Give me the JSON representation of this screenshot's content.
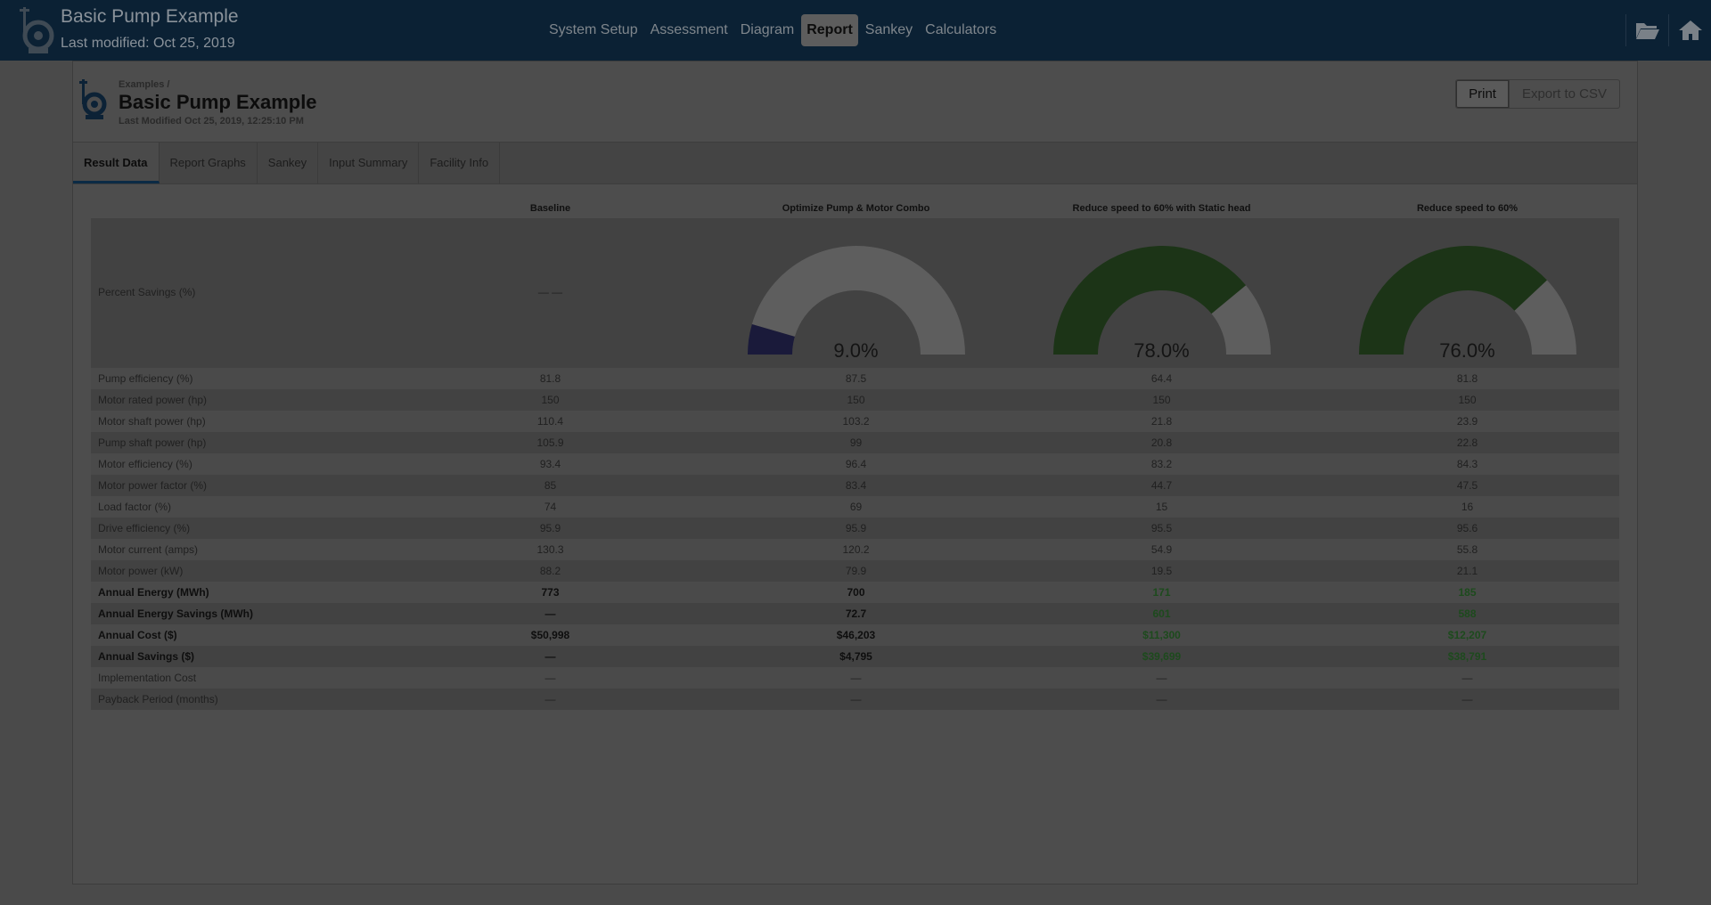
{
  "app": {
    "title": "Basic Pump Example",
    "modified": "Last modified: Oct 25, 2019"
  },
  "nav": {
    "items": [
      "System Setup",
      "Assessment",
      "Diagram",
      "Report",
      "Sankey",
      "Calculators"
    ],
    "active": "Report"
  },
  "icons": {
    "folder": "folder-open-icon",
    "home": "home-icon",
    "logo": "pump-logo-icon"
  },
  "report": {
    "breadcrumb": "Examples /",
    "title": "Basic Pump Example",
    "modified": "Last Modified Oct 25, 2019, 12:25:10 PM",
    "print_label": "Print",
    "export_label": "Export to CSV",
    "tabs": [
      "Result Data",
      "Report Graphs",
      "Sankey",
      "Input Summary",
      "Facility Info"
    ],
    "active_tab": "Result Data"
  },
  "table": {
    "columns": [
      "Baseline",
      "Optimize Pump & Motor Combo",
      "Reduce speed to 60% with Static head",
      "Reduce speed to 60%"
    ],
    "gauge_row": {
      "label": "Percent Savings (%)",
      "baseline": "— —",
      "gauges": [
        {
          "percent": 9.0,
          "display": "9.0%",
          "color": "#1a1a3a"
        },
        {
          "percent": 78.0,
          "display": "78.0%",
          "color": "#1c3417"
        },
        {
          "percent": 76.0,
          "display": "76.0%",
          "color": "#1c3417"
        }
      ],
      "track_color": "#5e5e5e"
    },
    "rows": [
      {
        "label": "Pump efficiency (%)",
        "values": [
          "81.8",
          "87.5",
          "64.4",
          "81.8"
        ],
        "bold": false
      },
      {
        "label": "Motor rated power (hp)",
        "values": [
          "150",
          "150",
          "150",
          "150"
        ],
        "bold": false
      },
      {
        "label": "Motor shaft power (hp)",
        "values": [
          "110.4",
          "103.2",
          "21.8",
          "23.9"
        ],
        "bold": false
      },
      {
        "label": "Pump shaft power (hp)",
        "values": [
          "105.9",
          "99",
          "20.8",
          "22.8"
        ],
        "bold": false
      },
      {
        "label": "Motor efficiency (%)",
        "values": [
          "93.4",
          "96.4",
          "83.2",
          "84.3"
        ],
        "bold": false
      },
      {
        "label": "Motor power factor (%)",
        "values": [
          "85",
          "83.4",
          "44.7",
          "47.5"
        ],
        "bold": false
      },
      {
        "label": "Load factor (%)",
        "values": [
          "74",
          "69",
          "15",
          "16"
        ],
        "bold": false
      },
      {
        "label": "Drive efficiency (%)",
        "values": [
          "95.9",
          "95.9",
          "95.5",
          "95.6"
        ],
        "bold": false
      },
      {
        "label": "Motor current (amps)",
        "values": [
          "130.3",
          "120.2",
          "54.9",
          "55.8"
        ],
        "bold": false
      },
      {
        "label": "Motor power (kW)",
        "values": [
          "88.2",
          "79.9",
          "19.5",
          "21.1"
        ],
        "bold": false
      },
      {
        "label": "Annual Energy (MWh)",
        "values": [
          "773",
          "700",
          "171",
          "185"
        ],
        "bold": true,
        "green": [
          2,
          3
        ]
      },
      {
        "label": "Annual Energy Savings (MWh)",
        "values": [
          "—",
          "72.7",
          "601",
          "588"
        ],
        "bold": true,
        "green": [
          2,
          3
        ]
      },
      {
        "label": "Annual Cost ($)",
        "values": [
          "$50,998",
          "$46,203",
          "$11,300",
          "$12,207"
        ],
        "bold": true,
        "green": [
          2,
          3
        ]
      },
      {
        "label": "Annual Savings ($)",
        "values": [
          "—",
          "$4,795",
          "$39,699",
          "$38,791"
        ],
        "bold": true,
        "green": [
          2,
          3
        ]
      },
      {
        "label": "Implementation Cost",
        "values": [
          "—",
          "—",
          "—",
          "—"
        ],
        "bold": false
      },
      {
        "label": "Payback Period (months)",
        "values": [
          "—",
          "—",
          "—",
          "—"
        ],
        "bold": false
      }
    ]
  }
}
